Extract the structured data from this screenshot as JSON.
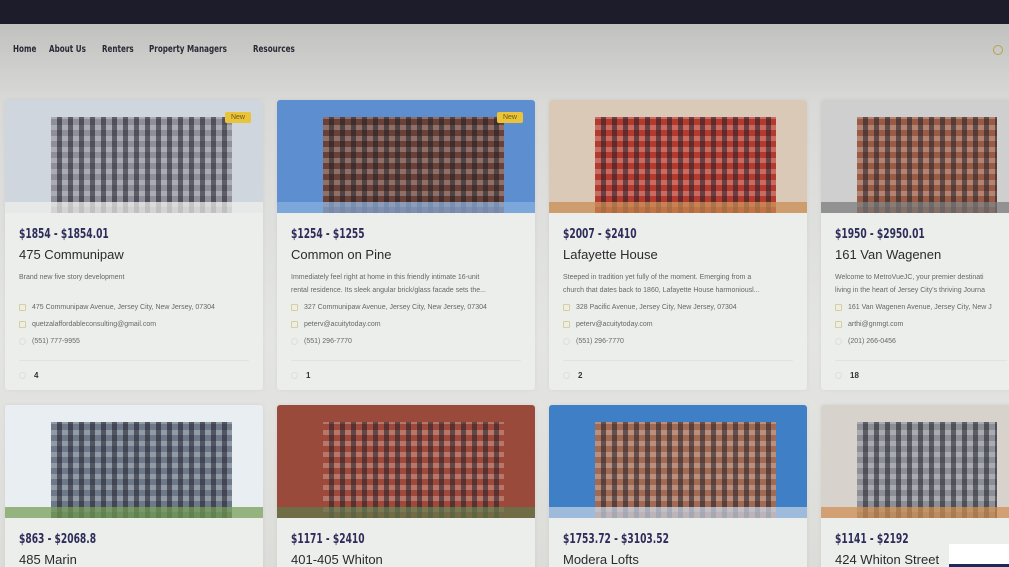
{
  "nav": {
    "items": [
      "Home",
      "About Us",
      "Renters",
      "Property Managers",
      "Resources"
    ]
  },
  "colors": {
    "price": "#2e2d5a",
    "badge": "#e9c33a",
    "topbar": "#1d1c2b"
  },
  "listings": [
    {
      "badge": "New",
      "price": "$1854 - $1854.01",
      "name": "475 Communipaw",
      "desc": [
        "Brand new five story development",
        ""
      ],
      "address": "475 Communipaw Avenue, Jersey City, New Jersey, 07304",
      "email": "quetzalaffordableconsulting@gmail.com",
      "phone": "(551) 777-9955",
      "units": "4"
    },
    {
      "badge": "New",
      "price": "$1254 - $1255",
      "name": "Common on Pine",
      "desc": [
        "Immediately feel right at home in this friendly intimate 16-unit",
        "rental residence. Its sleek angular brick/glass facade sets the..."
      ],
      "address": "327 Communipaw Avenue, Jersey City, New Jersey, 07304",
      "email": "peterv@acuitytoday.com",
      "phone": "(551) 296-7770",
      "units": "1"
    },
    {
      "price": "$2007 - $2410",
      "name": "Lafayette House",
      "desc": [
        "Steeped in tradition yet fully of the moment. Emerging from a",
        "church that dates back to 1860, Lafayette House harmoniousl..."
      ],
      "address": "328 Pacific Avenue, Jersey City, New Jersey, 07304",
      "email": "peterv@acuitytoday.com",
      "phone": "(551) 296-7770",
      "units": "2"
    },
    {
      "price": "$1950 - $2950.01",
      "name": "161 Van Wagenen",
      "desc": [
        "Welcome to MetroVueJC, your premier destinati",
        "living in the heart of Jersey City's thriving Journa"
      ],
      "address": "161 Van Wagenen Avenue, Jersey City, New J",
      "email": "arthi@gnmgt.com",
      "phone": "(201) 266-0456",
      "units": "18"
    },
    {
      "price": "$863 - $2068.8",
      "name": "485 Marin"
    },
    {
      "price": "$1171 - $2410",
      "name": "401-405 Whiton"
    },
    {
      "price": "$1753.72 - $3103.52",
      "name": "Modera Lofts"
    },
    {
      "price": "$1141 - $2192",
      "name": "424 Whiton Street"
    }
  ]
}
